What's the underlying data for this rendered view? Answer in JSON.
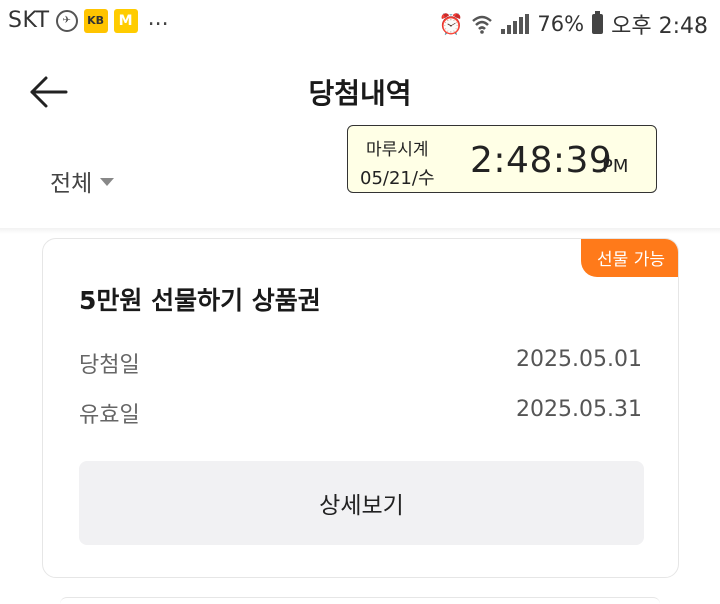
{
  "status_bar": {
    "carrier": "SKT",
    "kb_icon_text": "KB",
    "m_icon_text": "M",
    "more": "...",
    "battery_percent": "76%",
    "time": "오후 2:48"
  },
  "header": {
    "title": "당첨내역"
  },
  "filter": {
    "selected": "전체"
  },
  "overlay_clock": {
    "name": "마루시계",
    "date": "05/21/수",
    "time": "2:48:39",
    "ampm": "PM"
  },
  "card": {
    "badge": "선물 가능",
    "title": "5만원 선물하기 상품권",
    "rows": [
      {
        "label": "당첨일",
        "value": "2025.05.01"
      },
      {
        "label": "유효일",
        "value": "2025.05.31"
      }
    ],
    "detail_button": "상세보기"
  },
  "colors": {
    "accent": "#ff7a1a",
    "button_bg": "#f1f1f3",
    "clock_bg": "#ffffe6"
  }
}
